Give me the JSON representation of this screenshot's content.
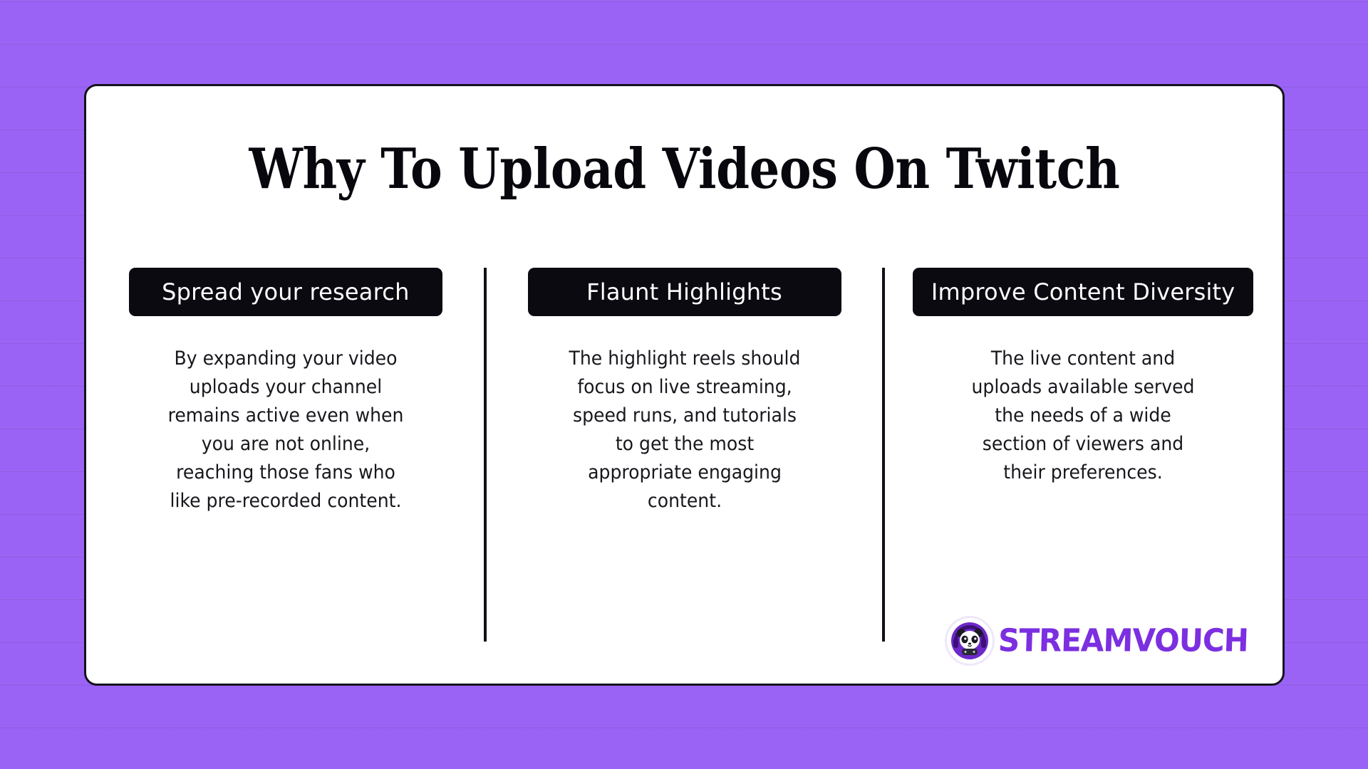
{
  "theme": {
    "background_color": "#9a63f5",
    "card_background": "#ffffff",
    "card_border_color": "#14131c",
    "badge_background": "#0a0a10",
    "badge_text_color": "#ffffff",
    "body_text_color": "#17171d",
    "divider_color": "#101018",
    "brand_purple": "#7c2fe0"
  },
  "headline": "Why To Upload Videos On Twitch",
  "columns": [
    {
      "badge": "Spread your research",
      "body": "By expanding your video uploads your channel remains active even when you are not online, reaching those fans who like pre-recorded content."
    },
    {
      "badge": "Flaunt Highlights",
      "body": "The highlight reels should focus on live streaming, speed runs, and tutorials to get the most appropriate engaging content."
    },
    {
      "badge": "Improve Content Diversity",
      "body": "The live content and uploads available served the needs of a wide section of viewers and their preferences."
    }
  ],
  "logo": {
    "mark_icon": "panda-headphones-icon",
    "wordmark": "STREAMVOUCH"
  }
}
